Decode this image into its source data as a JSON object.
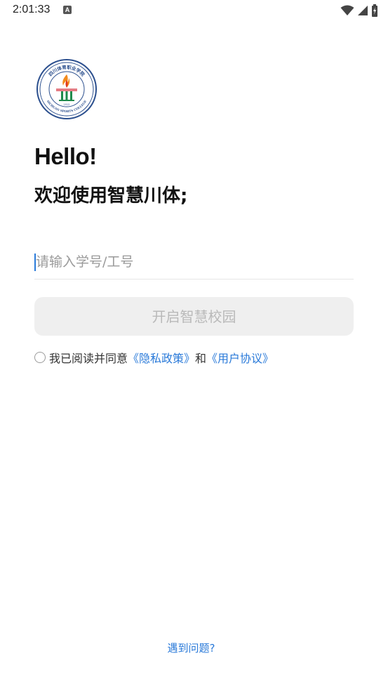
{
  "status_bar": {
    "time": "2:01:33",
    "notification_letter": "A"
  },
  "logo": {
    "arc_text": "四川体育职业学院",
    "ring_text": "SICHUAN SPORTS COLLEGE",
    "year": "1912"
  },
  "greeting": {
    "hello": "Hello!",
    "welcome": "欢迎使用智慧川体;"
  },
  "login": {
    "id_placeholder": "请输入学号/工号",
    "id_value": "",
    "submit_label": "开启智慧校园"
  },
  "agreement": {
    "prefix": "我已阅读并同意",
    "privacy_link": "《隐私政策》",
    "conjunction": "和",
    "terms_link": "《用户协议》"
  },
  "help": {
    "label": "遇到问题?"
  },
  "colors": {
    "accent": "#2a7ad9",
    "button_bg": "#efefef",
    "button_text": "#b9b9b9",
    "logo_blue": "#2b4f8e",
    "logo_green": "#1f8a4c",
    "flame": "#f28a1c"
  }
}
